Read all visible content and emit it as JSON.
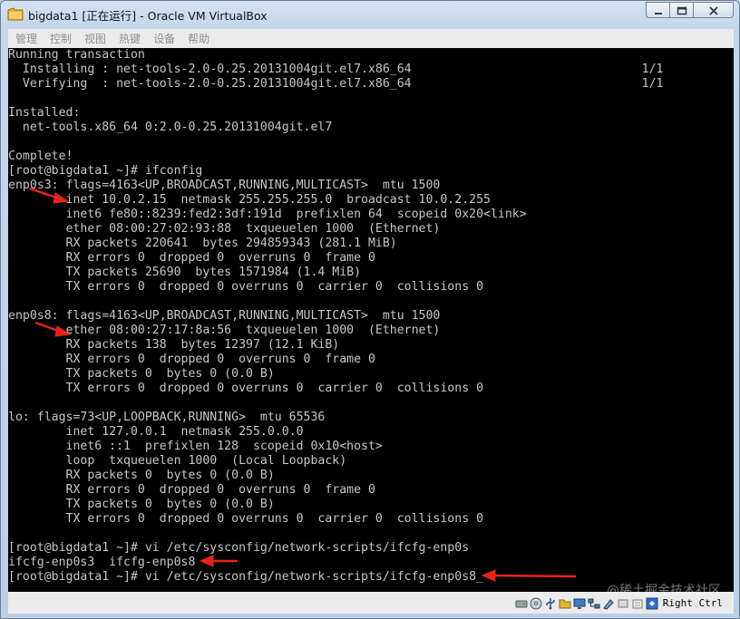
{
  "window": {
    "title": "bigdata1 [正在运行] - Oracle VM VirtualBox"
  },
  "menu": {
    "items": [
      "管理",
      "控制",
      "视图",
      "热键",
      "设备",
      "帮助"
    ]
  },
  "terminal": {
    "lines": [
      "Running transaction",
      "  Installing : net-tools-2.0-0.25.20131004git.el7.x86_64                                1/1",
      "  Verifying  : net-tools-2.0-0.25.20131004git.el7.x86_64                                1/1",
      "",
      "Installed:",
      "  net-tools.x86_64 0:2.0-0.25.20131004git.el7",
      "",
      "Complete!",
      "[root@bigdata1 ~]# ifconfig",
      "enp0s3: flags=4163<UP,BROADCAST,RUNNING,MULTICAST>  mtu 1500",
      "        inet 10.0.2.15  netmask 255.255.255.0  broadcast 10.0.2.255",
      "        inet6 fe80::8239:fed2:3df:191d  prefixlen 64  scopeid 0x20<link>",
      "        ether 08:00:27:02:93:88  txqueuelen 1000  (Ethernet)",
      "        RX packets 220641  bytes 294859343 (281.1 MiB)",
      "        RX errors 0  dropped 0  overruns 0  frame 0",
      "        TX packets 25690  bytes 1571984 (1.4 MiB)",
      "        TX errors 0  dropped 0 overruns 0  carrier 0  collisions 0",
      "",
      "enp0s8: flags=4163<UP,BROADCAST,RUNNING,MULTICAST>  mtu 1500",
      "        ether 08:00:27:17:8a:56  txqueuelen 1000  (Ethernet)",
      "        RX packets 138  bytes 12397 (12.1 KiB)",
      "        RX errors 0  dropped 0  overruns 0  frame 0",
      "        TX packets 0  bytes 0 (0.0 B)",
      "        TX errors 0  dropped 0 overruns 0  carrier 0  collisions 0",
      "",
      "lo: flags=73<UP,LOOPBACK,RUNNING>  mtu 65536",
      "        inet 127.0.0.1  netmask 255.0.0.0",
      "        inet6 ::1  prefixlen 128  scopeid 0x10<host>",
      "        loop  txqueuelen 1000  (Local Loopback)",
      "        RX packets 0  bytes 0 (0.0 B)",
      "        RX errors 0  dropped 0  overruns 0  frame 0",
      "        TX packets 0  bytes 0 (0.0 B)",
      "        TX errors 0  dropped 0 overruns 0  carrier 0  collisions 0",
      "",
      "[root@bigdata1 ~]# vi /etc/sysconfig/network-scripts/ifcfg-enp0s",
      "ifcfg-enp0s3  ifcfg-enp0s8",
      "[root@bigdata1 ~]# vi /etc/sysconfig/network-scripts/ifcfg-enp0s8"
    ],
    "cursor": "_"
  },
  "statusbar": {
    "host_key": "Right Ctrl"
  },
  "watermark": "@稀土掘金技术社区",
  "colors": {
    "annotation_arrow": "#e8231a",
    "terminal_text": "#c6c6c6",
    "terminal_bg": "#000000"
  },
  "icons": [
    "vbox-app-icon",
    "minimize-icon",
    "maximize-icon",
    "close-icon",
    "hdd-icon",
    "optical-icon",
    "usb-icon",
    "shared-folders-icon",
    "display-icon",
    "network-icon",
    "recording-icon",
    "cpu-icon",
    "mouse-icon",
    "keyboard-icon"
  ]
}
